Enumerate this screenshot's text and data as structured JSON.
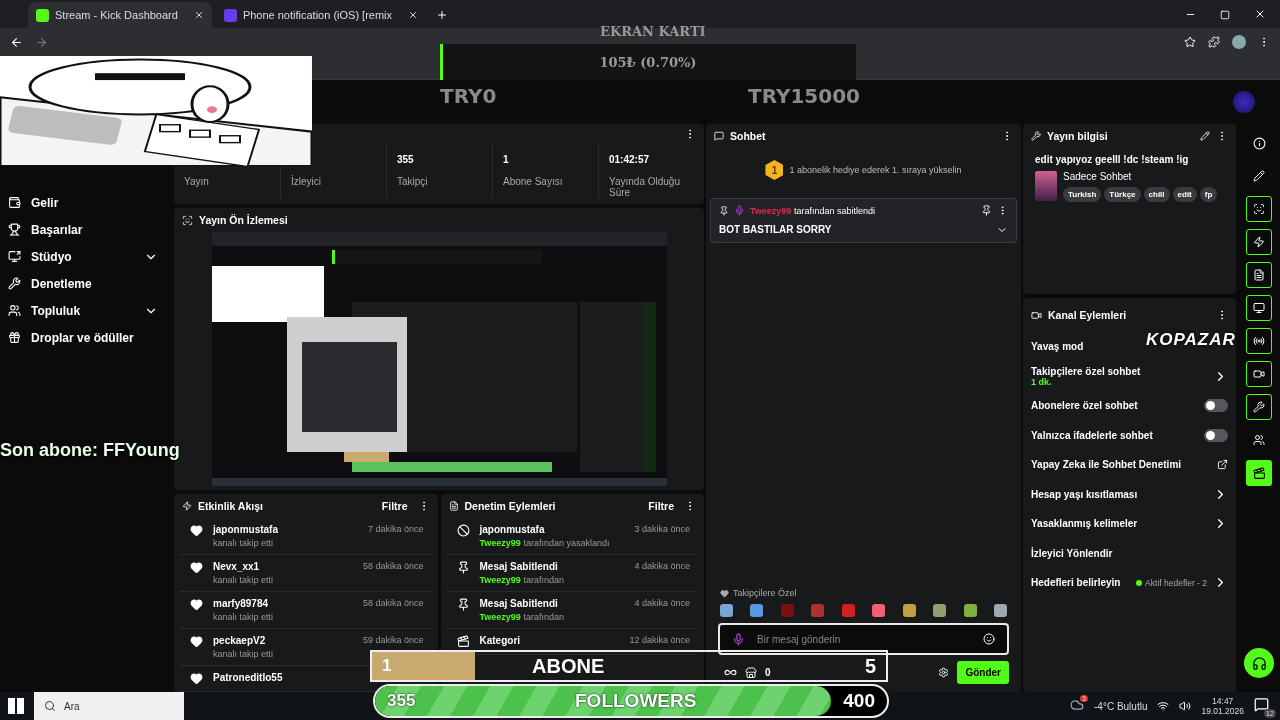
{
  "browser": {
    "tabs": [
      {
        "title": "Stream - Kick Dashboard",
        "selected": true
      },
      {
        "title": "Phone notification (iOS) [remix",
        "selected": false
      }
    ]
  },
  "overlays": {
    "goal_title": "EKRAN KARTI",
    "goal_bar": {
      "amount": "105₺ (0.70%)",
      "level": 0.007
    },
    "goal_min": "TRY0",
    "goal_max": "TRY15000",
    "last_sub": "Son abone: FFYoung",
    "sub_bar": {
      "current": "1",
      "label": "ABONE",
      "target": "5",
      "level": 0.2
    },
    "follower_bar": {
      "current": "355",
      "label": "FOLLOWERS",
      "target": "400",
      "level": 0.89
    },
    "logo": "KOPAZAR"
  },
  "sidebar": {
    "items": [
      {
        "label": "Gelir",
        "expandable": false
      },
      {
        "label": "Başarılar",
        "expandable": false
      },
      {
        "label": "Stüdyo",
        "expandable": true
      },
      {
        "label": "Denetleme",
        "expandable": false
      },
      {
        "label": "Topluluk",
        "expandable": true
      },
      {
        "label": "Droplar ve ödüller",
        "expandable": false
      }
    ]
  },
  "stats": [
    {
      "label": "Yayın"
    },
    {
      "label": "İzleyici"
    },
    {
      "value": "355",
      "label": "Takipçi"
    },
    {
      "value": "1",
      "label": "Abone Sayısı"
    },
    {
      "value": "01:42:57",
      "label": "Yayında Olduğu Süre"
    }
  ],
  "preview": {
    "title": "Yayın Ön İzlemesi"
  },
  "activity": {
    "title": "Etkinlik Akışı",
    "filter": "Filtre",
    "items": [
      {
        "name": "japonmustafa",
        "text": "kanalı takip etti",
        "time": "7 dakika önce"
      },
      {
        "name": "Nevx_xx1",
        "text": "kanalı takip etti",
        "time": "58 dakika önce"
      },
      {
        "name": "marfy89784",
        "text": "kanalı takip etti",
        "time": "58 dakika önce"
      },
      {
        "name": "peckaepV2",
        "text": "kanalı takip etti",
        "time": "59 dakika önce"
      },
      {
        "name": "Patroneditlo55"
      }
    ]
  },
  "moderation": {
    "title": "Denetim Eylemleri",
    "filter": "Filtre",
    "items": [
      {
        "kind": "ban",
        "name": "japonmustafa",
        "actor": "Tweezy99",
        "text": "tarafından yasaklandı",
        "time": "3 dakika önce"
      },
      {
        "kind": "pin",
        "name": "Mesaj Sabitlendi",
        "actor": "Tweezy99",
        "text": "tarafından",
        "time": "4 dakika önce"
      },
      {
        "kind": "pin",
        "name": "Mesaj Sabitlendi",
        "actor": "Tweezy99",
        "text": "tarafından",
        "time": "4 dakika önce"
      },
      {
        "kind": "category",
        "name": "Kategori",
        "time": "12 dakika önce"
      }
    ]
  },
  "chat": {
    "title": "Sohbet",
    "rank_badge": "1",
    "rank_text": "1 abonelik hediye ederek 1. sıraya yükselin",
    "pinned": {
      "user": "Tweezy99",
      "suffix": "tarafından sabitlendi",
      "message": "BOT BASTILAR SORRY"
    },
    "emote_label": "Takipçilere Özel",
    "placeholder": "Bir mesaj gönderin",
    "points": "0",
    "send": "Gönder"
  },
  "stream_info": {
    "title": "Yayın bilgisi",
    "stream_title": "edit yapıyoz geelll !dc !steam !ig",
    "category": "Sadece Sohbet",
    "tags": [
      "Turkish",
      "Türkçe",
      "chill",
      "edit",
      "fp"
    ]
  },
  "channel_actions": {
    "title": "Kanal Eylemleri",
    "items": [
      {
        "kind": "plain",
        "label": "Yavaş mod"
      },
      {
        "kind": "link",
        "label": "Takipçilere özel sohbet",
        "sub": "1 dk."
      },
      {
        "kind": "toggle",
        "label": "Abonelere özel sohbet",
        "on": false
      },
      {
        "kind": "toggle",
        "label": "Yalnızca ifadelerle sohbet",
        "on": false
      },
      {
        "kind": "external",
        "label": "Yapay Zeka ile Sohbet Denetimi"
      },
      {
        "kind": "link",
        "label": "Hesap yaşı kısıtlaması"
      },
      {
        "kind": "link",
        "label": "Yasaklanmış kelimeler"
      },
      {
        "kind": "plain",
        "label": "İzleyici Yönlendir"
      },
      {
        "kind": "link",
        "label": "Hedefleri belirleyin",
        "status": "Aktif hedefler - 2",
        "color": "#53fc18"
      }
    ]
  },
  "taskbar": {
    "search": "Ara",
    "weather": "-4°C Bulutlu",
    "weather_badge": "3",
    "time": "14:47",
    "date": "19.01.2026",
    "notifications": "12"
  }
}
